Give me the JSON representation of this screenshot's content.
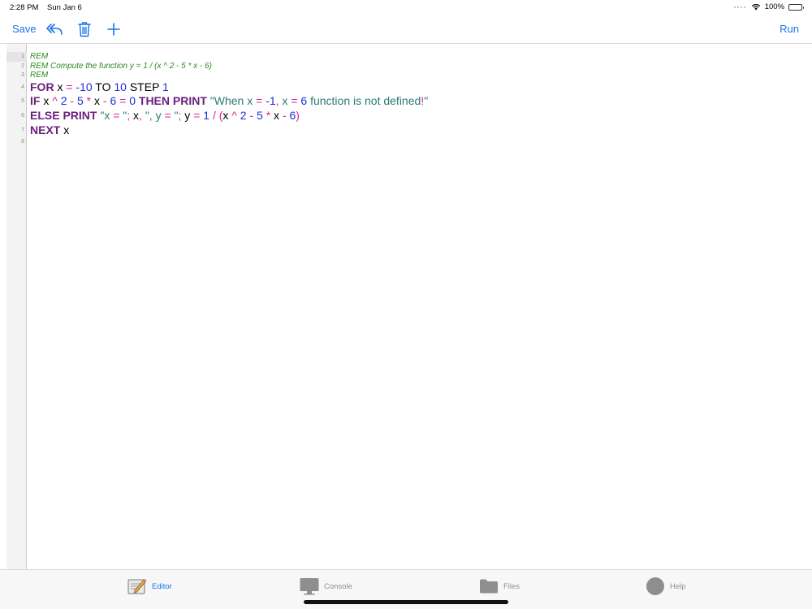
{
  "status": {
    "time": "2:28 PM",
    "date": "Sun Jan 6",
    "battery": "100%"
  },
  "toolbar": {
    "save_label": "Save",
    "run_label": "Run"
  },
  "editor": {
    "line_numbers": [
      "1",
      "2",
      "3",
      "4",
      "5",
      "6",
      "7",
      "8"
    ],
    "code": [
      {
        "type": "rem",
        "tokens": [
          {
            "c": "rem",
            "t": "REM"
          }
        ]
      },
      {
        "type": "rem",
        "tokens": [
          {
            "c": "rem",
            "t": "REM Compute the function y = 1 / (x ^ 2 - 5 * x - 6)"
          }
        ]
      },
      {
        "type": "rem",
        "tokens": [
          {
            "c": "rem",
            "t": "REM"
          }
        ]
      },
      {
        "type": "big",
        "tokens": [
          {
            "c": "kw",
            "t": "FOR"
          },
          {
            "c": "pl",
            "t": " x "
          },
          {
            "c": "op",
            "t": "="
          },
          {
            "c": "pl",
            "t": " "
          },
          {
            "c": "num",
            "t": "-10"
          },
          {
            "c": "pl",
            "t": " TO "
          },
          {
            "c": "num",
            "t": "10"
          },
          {
            "c": "pl",
            "t": " STEP "
          },
          {
            "c": "num",
            "t": "1"
          }
        ]
      },
      {
        "type": "big",
        "tokens": [
          {
            "c": "kw",
            "t": "IF"
          },
          {
            "c": "pl",
            "t": " x "
          },
          {
            "c": "op",
            "t": "^"
          },
          {
            "c": "pl",
            "t": " "
          },
          {
            "c": "num",
            "t": "2"
          },
          {
            "c": "pl",
            "t": " "
          },
          {
            "c": "op",
            "t": "-"
          },
          {
            "c": "pl",
            "t": " "
          },
          {
            "c": "num",
            "t": "5"
          },
          {
            "c": "pl",
            "t": " "
          },
          {
            "c": "op",
            "t": "*"
          },
          {
            "c": "pl",
            "t": " x "
          },
          {
            "c": "op",
            "t": "-"
          },
          {
            "c": "pl",
            "t": " "
          },
          {
            "c": "num",
            "t": "6"
          },
          {
            "c": "pl",
            "t": " "
          },
          {
            "c": "op",
            "t": "="
          },
          {
            "c": "pl",
            "t": " "
          },
          {
            "c": "num",
            "t": "0"
          },
          {
            "c": "pl",
            "t": " "
          },
          {
            "c": "kw",
            "t": "THEN PRINT"
          },
          {
            "c": "pl",
            "t": " "
          },
          {
            "c": "str",
            "t": "\"When x "
          },
          {
            "c": "op",
            "t": "="
          },
          {
            "c": "str",
            "t": " "
          },
          {
            "c": "num",
            "t": "-1"
          },
          {
            "c": "op",
            "t": ","
          },
          {
            "c": "str",
            "t": " x "
          },
          {
            "c": "op",
            "t": "="
          },
          {
            "c": "str",
            "t": " "
          },
          {
            "c": "num",
            "t": "6"
          },
          {
            "c": "str",
            "t": " function is not defined"
          },
          {
            "c": "op",
            "t": "!"
          },
          {
            "c": "str",
            "t": "\""
          }
        ]
      },
      {
        "type": "big",
        "tokens": [
          {
            "c": "kw",
            "t": "ELSE PRINT"
          },
          {
            "c": "pl",
            "t": " "
          },
          {
            "c": "str",
            "t": "\"x "
          },
          {
            "c": "op",
            "t": "="
          },
          {
            "c": "str",
            "t": " \""
          },
          {
            "c": "op",
            "t": ";"
          },
          {
            "c": "pl",
            "t": " x"
          },
          {
            "c": "op",
            "t": ","
          },
          {
            "c": "pl",
            "t": " "
          },
          {
            "c": "str",
            "t": "\", y "
          },
          {
            "c": "op",
            "t": "="
          },
          {
            "c": "str",
            "t": " \""
          },
          {
            "c": "op",
            "t": ";"
          },
          {
            "c": "pl",
            "t": " y "
          },
          {
            "c": "op",
            "t": "="
          },
          {
            "c": "pl",
            "t": " "
          },
          {
            "c": "num",
            "t": "1"
          },
          {
            "c": "pl",
            "t": " "
          },
          {
            "c": "op",
            "t": "/"
          },
          {
            "c": "pl",
            "t": " "
          },
          {
            "c": "op",
            "t": "("
          },
          {
            "c": "pl",
            "t": "x "
          },
          {
            "c": "op",
            "t": "^"
          },
          {
            "c": "pl",
            "t": " "
          },
          {
            "c": "num",
            "t": "2"
          },
          {
            "c": "pl",
            "t": " "
          },
          {
            "c": "op",
            "t": "-"
          },
          {
            "c": "pl",
            "t": " "
          },
          {
            "c": "num",
            "t": "5"
          },
          {
            "c": "pl",
            "t": " "
          },
          {
            "c": "op",
            "t": "*"
          },
          {
            "c": "pl",
            "t": " x "
          },
          {
            "c": "op",
            "t": "-"
          },
          {
            "c": "pl",
            "t": " "
          },
          {
            "c": "num",
            "t": "6"
          },
          {
            "c": "op",
            "t": ")"
          }
        ]
      },
      {
        "type": "big",
        "tokens": [
          {
            "c": "kw",
            "t": "NEXT"
          },
          {
            "c": "pl",
            "t": " x"
          }
        ]
      },
      {
        "type": "rem",
        "tokens": []
      }
    ]
  },
  "tabs": [
    {
      "label": "Editor",
      "icon": "editor-icon",
      "active": true
    },
    {
      "label": "Console",
      "icon": "console-icon",
      "active": false
    },
    {
      "label": "Files",
      "icon": "folder-icon",
      "active": false
    },
    {
      "label": "Help",
      "icon": "help-icon",
      "active": false
    }
  ],
  "colors": {
    "accent": "#1a73e8",
    "keyword": "#6b1e7c",
    "number": "#1f2fd6",
    "operator": "#e0248f",
    "string": "#2a7a73",
    "comment": "#2b8a1f"
  }
}
